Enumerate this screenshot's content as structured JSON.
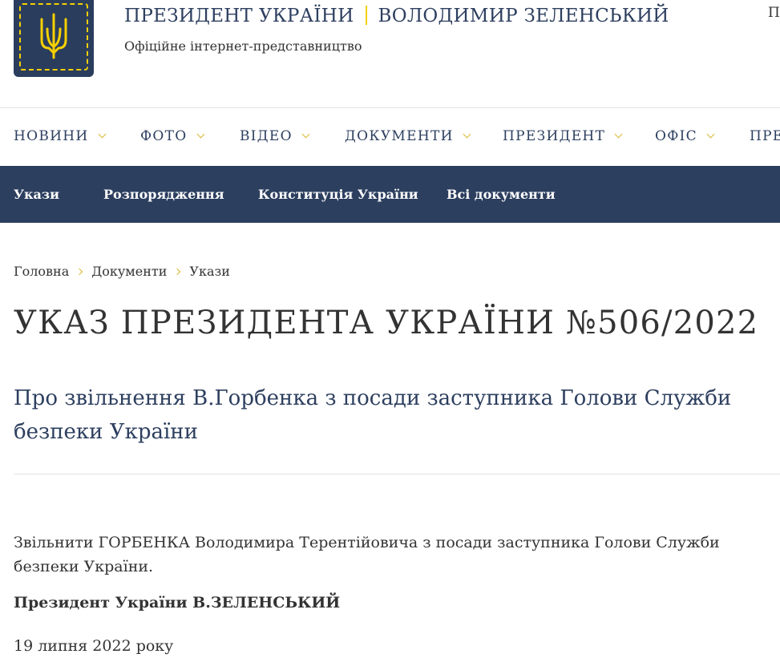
{
  "header": {
    "title_left": "ПРЕЗИДЕНТ УКРАЇНИ",
    "title_right": "ВОЛОДИМИР ЗЕЛЕНСЬКИЙ",
    "subtitle": "Офіційне інтернет-представництво",
    "cutoff_link": "П",
    "logo_icon": "trident-emblem-icon",
    "colors": {
      "navy": "#2d3f5f",
      "gold": "#f5d000"
    }
  },
  "main_nav": {
    "items": [
      {
        "label": "НОВИНИ"
      },
      {
        "label": "ФОТО"
      },
      {
        "label": "ВІДЕО"
      },
      {
        "label": "ДОКУМЕНТИ"
      },
      {
        "label": "ПРЕЗИДЕНТ"
      },
      {
        "label": "ОФІС"
      },
      {
        "label": "ПРЕ"
      }
    ]
  },
  "sub_nav": {
    "items": [
      {
        "label": "Укази"
      },
      {
        "label": "Розпорядження"
      },
      {
        "label": "Конституція України"
      },
      {
        "label": "Всі документи"
      }
    ]
  },
  "breadcrumb": {
    "items": [
      {
        "label": "Головна"
      },
      {
        "label": "Документи"
      },
      {
        "label": "Укази"
      }
    ]
  },
  "document": {
    "title": "УКАЗ ПРЕЗИДЕНТА УКРАЇНИ №506/2022",
    "subtitle": "Про звільнення В.Горбенка з посади заступника Голови Служби безпеки України",
    "body": "Звільнити ГОРБЕНКА Володимира Терентійовича з посади заступника Голови Служби безпеки України.",
    "signature": "Президент України В.ЗЕЛЕНСЬКИЙ",
    "date": "19 липня 2022 року"
  }
}
